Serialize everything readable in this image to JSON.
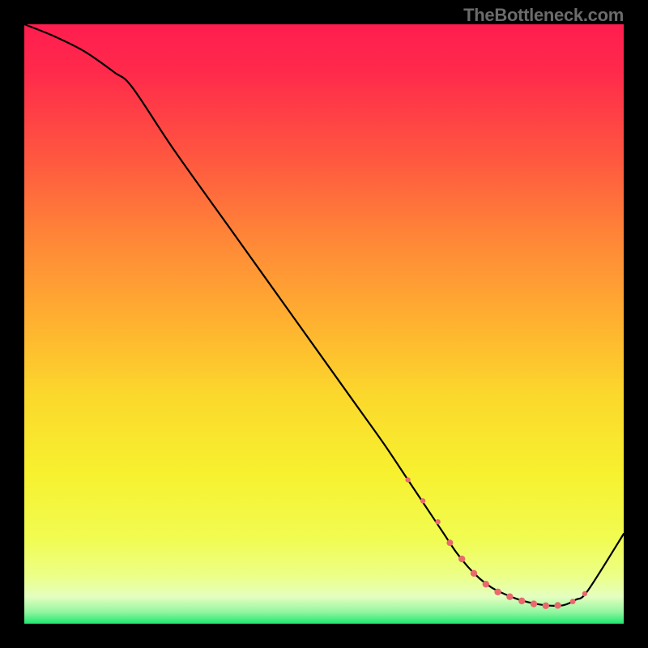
{
  "watermark": "TheBottleneck.com",
  "chart_data": {
    "type": "line",
    "title": "",
    "xlabel": "",
    "ylabel": "",
    "xlim": [
      0,
      100
    ],
    "ylim": [
      0,
      100
    ],
    "grid": false,
    "legend": false,
    "series": [
      {
        "name": "curve",
        "x": [
          0,
          5,
          10,
          15,
          18,
          25,
          35,
          45,
          55,
          60,
          64,
          68,
          70,
          72,
          74,
          76,
          78,
          80,
          82,
          84,
          86,
          88,
          90,
          92,
          94,
          100
        ],
        "values": [
          100,
          98,
          95.5,
          92,
          89.5,
          79,
          65,
          51,
          37,
          30,
          24,
          18,
          15,
          12,
          9.5,
          7.5,
          6,
          5,
          4.2,
          3.6,
          3.2,
          3.0,
          3.1,
          4.0,
          5.5,
          15
        ]
      }
    ],
    "markers": {
      "name": "highlight-dots",
      "x": [
        64,
        66.5,
        69,
        71,
        73,
        75,
        77,
        79,
        81,
        83,
        85,
        87,
        89,
        91.5,
        93.5
      ],
      "values": [
        24,
        20.5,
        17,
        13.5,
        10.8,
        8.4,
        6.6,
        5.3,
        4.5,
        3.8,
        3.3,
        3.0,
        3.05,
        3.7,
        5.0
      ],
      "radii": [
        3.2,
        3.2,
        3.2,
        4.0,
        4.2,
        4.2,
        4.2,
        4.2,
        4.2,
        4.2,
        4.2,
        4.2,
        4.2,
        3.4,
        3.2
      ]
    },
    "gradient_stops": [
      {
        "offset": 0.0,
        "color": "#ff1d4f"
      },
      {
        "offset": 0.08,
        "color": "#ff2a4b"
      },
      {
        "offset": 0.22,
        "color": "#ff5640"
      },
      {
        "offset": 0.35,
        "color": "#ff8438"
      },
      {
        "offset": 0.5,
        "color": "#ffb230"
      },
      {
        "offset": 0.62,
        "color": "#fbd82c"
      },
      {
        "offset": 0.75,
        "color": "#f7f12f"
      },
      {
        "offset": 0.86,
        "color": "#f1fc52"
      },
      {
        "offset": 0.92,
        "color": "#ecff87"
      },
      {
        "offset": 0.955,
        "color": "#e4ffc0"
      },
      {
        "offset": 0.98,
        "color": "#95f6a0"
      },
      {
        "offset": 1.0,
        "color": "#1ee86f"
      }
    ],
    "curve_color": "#000000",
    "marker_color": "#e86a6d"
  }
}
